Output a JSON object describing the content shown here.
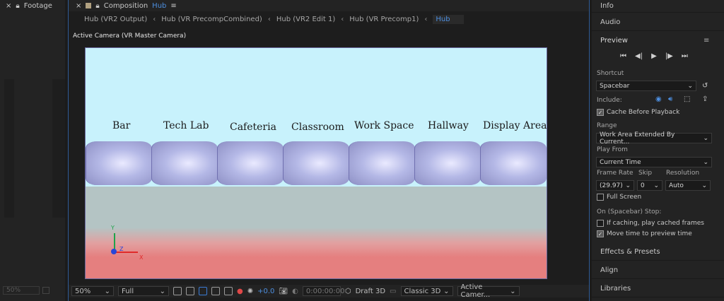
{
  "footage_panel": {
    "tab_label": "Footage",
    "zoom_value": "50%"
  },
  "composition_panel": {
    "tab_prefix": "Composition",
    "tab_name": "Hub",
    "breadcrumbs": [
      "Hub (VR2 Output)",
      "Hub (VR PrecompCombined)",
      "Hub (VR2 Edit 1)",
      "Hub (VR Precomp1)",
      "Hub"
    ],
    "camera_label": "Active Camera (VR Master Camera)",
    "room_labels": [
      "Bar",
      "Tech Lab",
      "Cafeteria",
      "Classroom",
      "Work Space",
      "Hallway",
      "Display Area"
    ],
    "gizmo": {
      "y": "Y",
      "x": "X",
      "z": "Z"
    },
    "bottom_bar": {
      "zoom": "50%",
      "resolution": "Full",
      "exposure": "+0.0",
      "timecode": "0:00:00:00",
      "draft_3d": "Draft 3D",
      "renderer": "Classic 3D",
      "view": "Active Camer..."
    }
  },
  "right_panel": {
    "sections_top": [
      "Info",
      "Audio"
    ],
    "preview_title": "Preview",
    "shortcut_label": "Shortcut",
    "shortcut_value": "Spacebar",
    "include_label": "Include:",
    "cache_before_playback": "Cache Before Playback",
    "range_label": "Range",
    "range_value": "Work Area Extended By Current...",
    "play_from_label": "Play From",
    "play_from_value": "Current Time",
    "frame_rate_label": "Frame Rate",
    "frame_rate_value": "(29.97)",
    "skip_label": "Skip",
    "skip_value": "0",
    "resolution_label": "Resolution",
    "resolution_value": "Auto",
    "full_screen": "Full Screen",
    "on_stop_label": "On (Spacebar) Stop:",
    "if_caching": "If caching, play cached frames",
    "move_time": "Move time to preview time",
    "sections_bottom": [
      "Effects & Presets",
      "Align",
      "Libraries"
    ]
  },
  "colors": {
    "accent": "#4d8fe0",
    "sky": "#c8f2fc",
    "floor_red": "#e57f7f"
  }
}
